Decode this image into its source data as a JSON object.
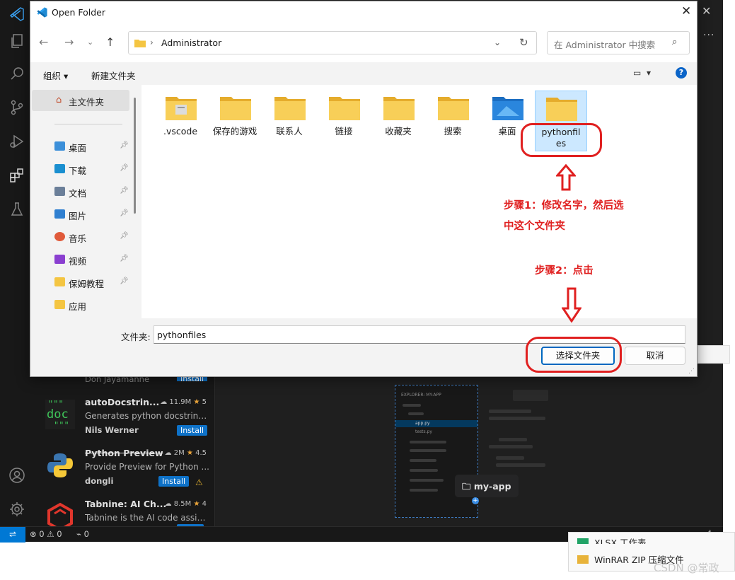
{
  "dialog": {
    "title": "Open Folder",
    "address": "Administrator",
    "search_placeholder": "在 Administrator 中搜索",
    "organize": "组织 ▾",
    "new_folder": "新建文件夹",
    "help": "?",
    "nav": {
      "home": "主文件夹",
      "items": [
        {
          "label": "桌面",
          "icon": "desktop-icon",
          "color": "#3b8fd9"
        },
        {
          "label": "下载",
          "icon": "download-icon",
          "color": "#1a8fd0"
        },
        {
          "label": "文档",
          "icon": "documents-icon",
          "color": "#6b7f99"
        },
        {
          "label": "图片",
          "icon": "pictures-icon",
          "color": "#2f7fd0"
        },
        {
          "label": "音乐",
          "icon": "music-icon",
          "color": "#e05a3a"
        },
        {
          "label": "视频",
          "icon": "videos-icon",
          "color": "#8a3fd0"
        },
        {
          "label": "保姆教程",
          "icon": "folder-icon",
          "color": "#f4c542"
        },
        {
          "label": "应用",
          "icon": "folder-icon",
          "color": "#f4c542"
        }
      ]
    },
    "files": [
      {
        "name": ".vscode",
        "selected": false
      },
      {
        "name": "保存的游戏",
        "selected": false
      },
      {
        "name": "联系人",
        "selected": false
      },
      {
        "name": "链接",
        "selected": false
      },
      {
        "name": "收藏夹",
        "selected": false
      },
      {
        "name": "搜索",
        "selected": false
      },
      {
        "name": "桌面",
        "selected": false
      },
      {
        "name": "pythonfiles",
        "selected": true
      }
    ],
    "folder_label": "文件夹:",
    "folder_value": "pythonfiles",
    "select_button": "选择文件夹",
    "cancel_button": "取消"
  },
  "annotations": {
    "step1_line1": "步骤1：修改名字，然后选",
    "step1_line2": "中这个文件夹",
    "step2": "步骤2：点击",
    "color": "#e02020"
  },
  "vscode": {
    "partial_author": "Don Jayamanne",
    "partial_install": "Install",
    "extensions": [
      {
        "name": "autoDocstrin...",
        "downloads": "11.9M",
        "rating": "5",
        "desc": "Generates python docstring...",
        "author": "Nils Werner",
        "install": "Install",
        "strike": false,
        "warning": false
      },
      {
        "name": "Python Preview",
        "downloads": "2M",
        "rating": "4.5",
        "desc": "Provide Preview for Python ...",
        "author": "dongli",
        "install": "Install",
        "strike": true,
        "warning": true
      },
      {
        "name": "Tabnine: AI Ch...",
        "downloads": "8.5M",
        "rating": "4",
        "desc": "Tabnine is the AI code assist...",
        "author": "",
        "install": "",
        "strike": false,
        "warning": false
      }
    ],
    "doc_logo": {
      "top": "\"\"\"",
      "middle": "doc",
      "bottom": "\"\"\""
    },
    "explorer_mock": {
      "header": "EXPLORER: MY-APP",
      "file1": "app.py",
      "file2": "tests.py"
    },
    "tooltip": "my-app",
    "status": {
      "errors": "0",
      "warnings": "0",
      "ports": "0"
    },
    "accent": "#0078d4"
  },
  "context_menu": {
    "item1": "XLSX 工作表",
    "item2": "WinRAR ZIP 压缩文件"
  },
  "watermark": "CSDN @常政"
}
